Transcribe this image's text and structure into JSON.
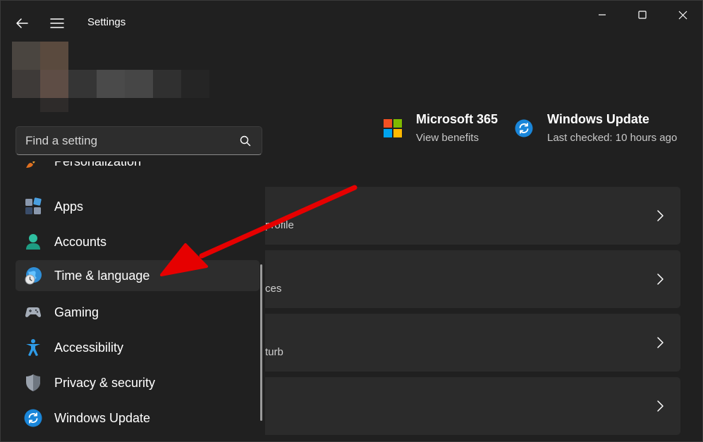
{
  "window": {
    "title": "Settings"
  },
  "search": {
    "placeholder": "Find a setting"
  },
  "nav": {
    "items": [
      {
        "label": "Personalization",
        "icon": "brush-icon"
      },
      {
        "label": "Apps",
        "icon": "apps-icon"
      },
      {
        "label": "Accounts",
        "icon": "person-icon"
      },
      {
        "label": "Time & language",
        "icon": "globe-clock-icon",
        "selected": true
      },
      {
        "label": "Gaming",
        "icon": "gamepad-icon"
      },
      {
        "label": "Accessibility",
        "icon": "accessibility-icon"
      },
      {
        "label": "Privacy & security",
        "icon": "shield-icon"
      },
      {
        "label": "Windows Update",
        "icon": "sync-icon"
      }
    ]
  },
  "header": {
    "microsoft365": {
      "title": "Microsoft 365",
      "subtitle": "View benefits"
    },
    "windows_update": {
      "title": "Windows Update",
      "subtitle": "Last checked: 10 hours ago"
    }
  },
  "cards": [
    {
      "subtitle": "profile"
    },
    {
      "subtitle": "ces"
    },
    {
      "subtitle": "turb"
    },
    {
      "subtitle": ""
    }
  ],
  "colors": {
    "background": "#202020",
    "card": "#2b2b2b",
    "accent": "#0078d4",
    "annotation_arrow": "#e60000"
  }
}
